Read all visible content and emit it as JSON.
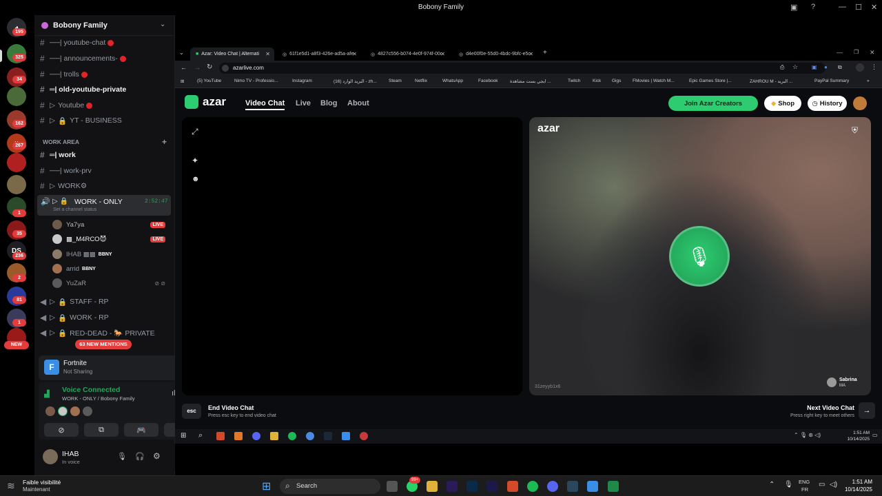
{
  "window": {
    "title": "Bobony Family"
  },
  "servers": {
    "badges": [
      "195",
      "325",
      "34",
      "162",
      "267",
      "1",
      "35",
      "236",
      "2",
      "81",
      "1"
    ],
    "ds_label": "DS",
    "new_label": "NEW"
  },
  "sidebar": {
    "server_name": "Bobony Family",
    "channels": [
      {
        "label": "──| youtube-chat",
        "red": true
      },
      {
        "label": "──| announcements-",
        "red": true
      },
      {
        "label": "──| trolls",
        "red": true
      },
      {
        "label": "═| old-youtube-private",
        "red": false
      },
      {
        "label": "Youtube",
        "red": true
      },
      {
        "label": "YT - BUSINESS",
        "red": false
      }
    ],
    "category": "WORK AREA",
    "work_channels": [
      {
        "label": "═| work"
      },
      {
        "label": "──| work-prv"
      },
      {
        "label": "WORK⚙"
      }
    ],
    "voice_channel": {
      "label": "WORK - ONLY",
      "timer": "2:52:47",
      "status": "Set a channel status"
    },
    "voice_users": [
      {
        "name": "Ya7ya",
        "tag": "LIVE"
      },
      {
        "name": "▩_M4RCO😈",
        "tag": "LIVE"
      },
      {
        "name": "IHAB ▩▩",
        "tag": "BBNY"
      },
      {
        "name": "arrid",
        "tag": "BBNY"
      },
      {
        "name": "YuZaR",
        "tag": ""
      }
    ],
    "more_channels": [
      {
        "label": "STAFF - RP"
      },
      {
        "label": "WORK - RP"
      },
      {
        "label": "RED-DEAD - 🐎 PRIVATE"
      }
    ],
    "mentions": "63 NEW MENTIONS",
    "activity": {
      "game": "Fortnite",
      "status": "Not Sharing"
    },
    "voice": {
      "title": "Voice Connected",
      "sub": "WORK - ONLY / Bobony Family"
    },
    "user": {
      "name": "IHAB",
      "status": "In voice"
    }
  },
  "browser": {
    "tabs": [
      {
        "label": "Azar: Video Chat | Alternati"
      },
      {
        "label": "61f1e5d1-a8f3-426e-ad5a-afe"
      },
      {
        "label": "4827c556-b074-4e0f-974f-00c"
      },
      {
        "label": "d4e00f0e-55d0-4bdc-9bfc-e5c"
      }
    ],
    "url": "azarlive.com",
    "bookmarks": [
      "(5) YouTube",
      "Nimo TV - Professio...",
      "Instagram",
      "(16) البريد الوارد - zh...",
      "Steam",
      "Netflix",
      "WhatsApp",
      "Facebook",
      "ايجي بست مشاهدة ...",
      "Twitch",
      "Kick",
      "Gigs",
      "FMovies | Watch M...",
      "Epic Games Store |...",
      "ZAHROU M - البريد ...",
      "PayPal Summary"
    ]
  },
  "azar": {
    "logo": "azar",
    "nav": [
      "Video Chat",
      "Live",
      "Blog",
      "About"
    ],
    "creators": "Join Azar Creators",
    "shop": "Shop",
    "history": "History",
    "watermark": "azar",
    "partner_id": "31zeyyb1x6",
    "partner_name": "Sabrina",
    "partner_country": "MA",
    "esc_key": "esc",
    "end_title": "End Video Chat",
    "end_sub": "Press esc key to end video chat",
    "next_title": "Next Video Chat",
    "next_sub": "Press right key to meet others"
  },
  "inner_taskbar": {
    "time": "1:51 AM",
    "date": "10/14/2025"
  },
  "taskbar": {
    "weather_title": "Faible visibilité",
    "weather_sub": "Maintenant",
    "search": "Search",
    "lang1": "ENG",
    "lang2": "FR",
    "time": "1:51 AM",
    "date": "10/14/2025",
    "badge": "99+"
  },
  "colors": {
    "accent_green": "#23a55a",
    "live_red": "#e23c3c",
    "mention_red": "#e23c3c"
  }
}
